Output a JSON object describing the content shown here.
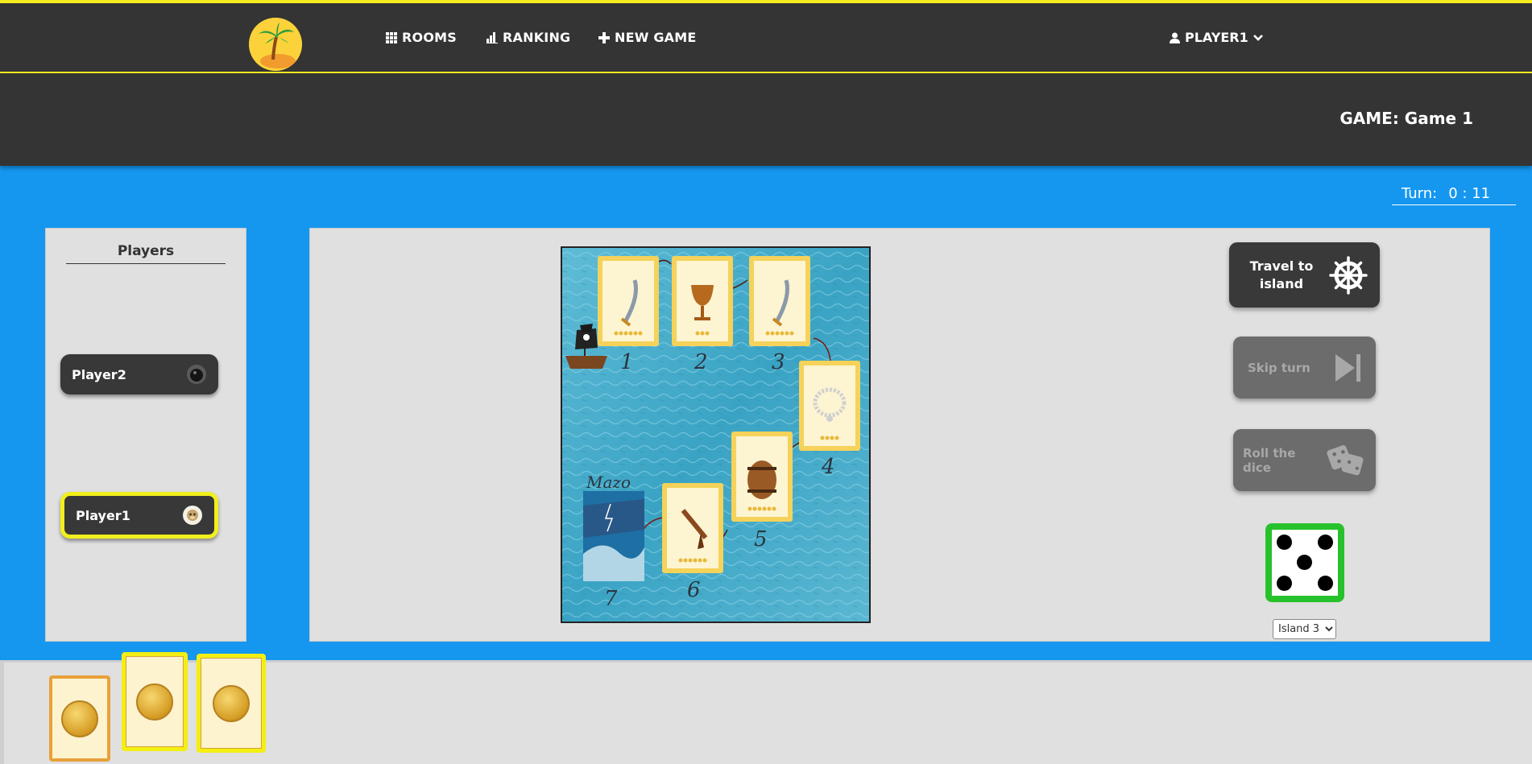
{
  "nav": {
    "logo": "palm-island-logo",
    "items": [
      {
        "label": "ROOMS",
        "icon": "grid-icon"
      },
      {
        "label": "RANKING",
        "icon": "ranking-icon"
      },
      {
        "label": "NEW GAME",
        "icon": "plus-icon"
      }
    ],
    "user": {
      "label": "PLAYER1",
      "icon": "user-icon",
      "caret": "chevron-down-icon"
    }
  },
  "header": {
    "game_title": "GAME: Game 1"
  },
  "turn": {
    "label": "Turn:",
    "time": "0 : 11"
  },
  "players": {
    "title": "Players",
    "list": [
      {
        "name": "Player2",
        "avatar": "black-avatar",
        "active": false
      },
      {
        "name": "Player1",
        "avatar": "monkey-avatar",
        "active": true
      }
    ]
  },
  "board": {
    "cards": [
      {
        "number": "1",
        "item": "sword",
        "coins": 6
      },
      {
        "number": "2",
        "item": "chalice",
        "coins": 3
      },
      {
        "number": "3",
        "item": "sword",
        "coins": 6
      },
      {
        "number": "4",
        "item": "necklace",
        "coins": 4
      },
      {
        "number": "5",
        "item": "rum-barrel",
        "coins": 6
      },
      {
        "number": "6",
        "item": "pistol",
        "coins": 6
      },
      {
        "number": "7",
        "item": "deck",
        "coins": 0
      }
    ],
    "deck_label": "Mazo",
    "ship": "pirate-ship-icon"
  },
  "actions": {
    "travel": {
      "label": "Travel to island",
      "icon": "ship-wheel-icon",
      "enabled": true
    },
    "skip": {
      "label": "Skip turn",
      "icon": "skip-icon",
      "enabled": false
    },
    "roll": {
      "label": "Roll the dice",
      "icon": "dice-icon",
      "enabled": false
    }
  },
  "dice": {
    "value": 5,
    "border_color": "#27c22b"
  },
  "island_select": {
    "selected": "Island 3",
    "options": [
      "Island 3"
    ]
  },
  "hand": {
    "cards": [
      {
        "type": "doubloon",
        "selected": false
      },
      {
        "type": "doubloon",
        "selected": true
      },
      {
        "type": "doubloon",
        "selected": true
      }
    ]
  },
  "colors": {
    "accent": "#f4ec1f",
    "background": "#1597f0",
    "nav": "#343434"
  }
}
